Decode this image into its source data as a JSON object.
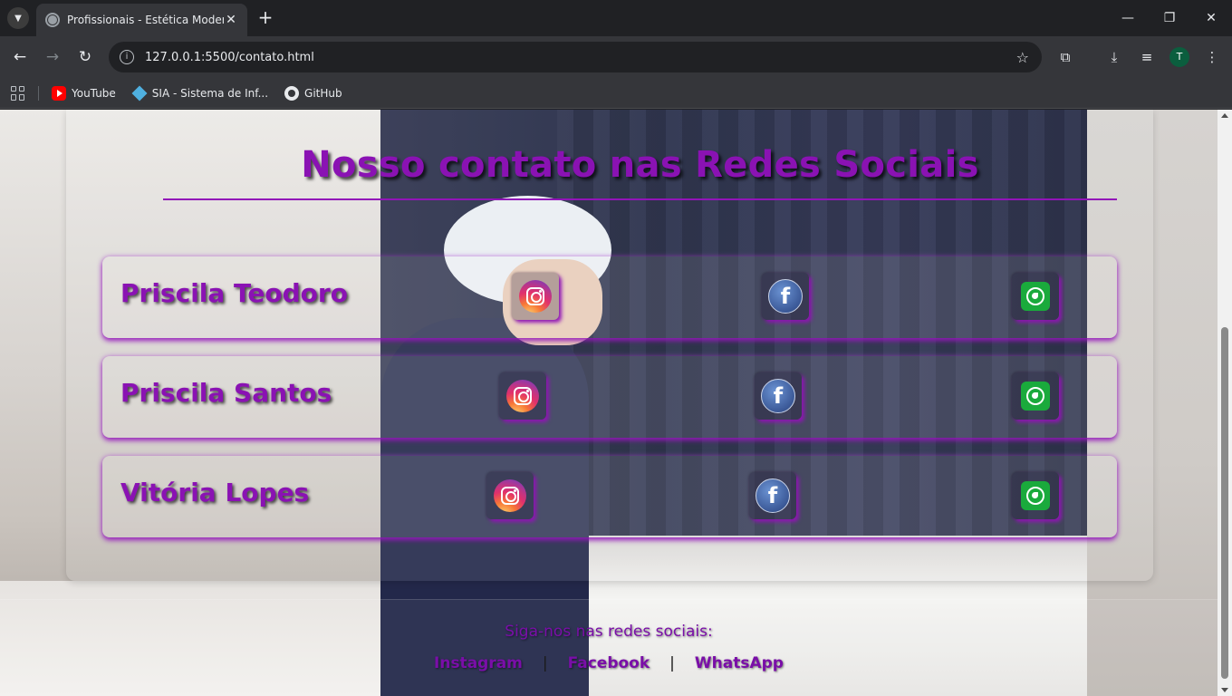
{
  "browser": {
    "tab_title": "Profissionais - Estética Moderna",
    "url": "127.0.0.1:5500/contato.html",
    "avatar_letter": "T",
    "bookmarks": [
      {
        "label": "YouTube",
        "icon": "youtube-icon"
      },
      {
        "label": "SIA - Sistema de Inf...",
        "icon": "sia-icon"
      },
      {
        "label": "GitHub",
        "icon": "github-icon"
      }
    ]
  },
  "page": {
    "title": "Nosso contato nas Redes Sociais",
    "contacts": [
      {
        "name": "Priscila Teodoro",
        "links": [
          "instagram-icon",
          "facebook-icon",
          "whatsapp-icon"
        ]
      },
      {
        "name": "Priscila Santos",
        "links": [
          "instagram-icon",
          "facebook-icon",
          "whatsapp-icon"
        ]
      },
      {
        "name": "Vitória Lopes",
        "links": [
          "instagram-icon",
          "facebook-icon",
          "whatsapp-icon"
        ]
      }
    ],
    "footer": {
      "follow_text": "Siga-nos nas redes sociais:",
      "links": [
        "Instagram",
        "Facebook",
        "WhatsApp"
      ],
      "separator": "|"
    }
  },
  "colors": {
    "accent": "#8a12b3",
    "instagram": "#e1306c",
    "facebook": "#3b5998",
    "whatsapp": "#1aaa3c"
  }
}
